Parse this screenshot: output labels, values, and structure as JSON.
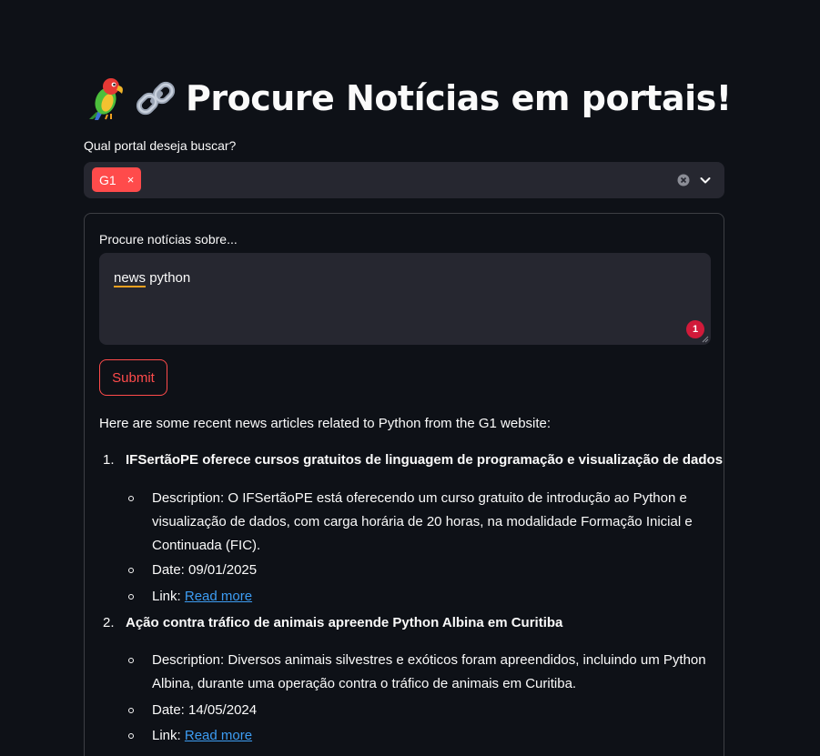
{
  "header": {
    "title": "Procure Notícias em portais!",
    "parrot_icon": "parrot-emoji",
    "link_icon": "link-emoji"
  },
  "portal_select": {
    "label": "Qual portal deseja buscar?",
    "selected_tag": "G1",
    "tag_remove": "×",
    "accent_color": "#ff4b4b"
  },
  "search_form": {
    "label": "Procure notícias sobre...",
    "textarea_value_word1": "news",
    "textarea_value_word2": " python",
    "badge_count": "1",
    "submit_label": "Submit"
  },
  "results": {
    "intro": "Here are some recent news articles related to Python from the G1 website:",
    "articles": [
      {
        "number": "1.",
        "title": "IFSertãoPE oferece cursos gratuitos de linguagem de programação e visualização de dados",
        "description": "Description: O IFSertãoPE está oferecendo um curso gratuito de introdução ao Python e visualização de dados, com carga horária de 20 horas, na modalidade Formação Inicial e Continuada (FIC).",
        "date": "Date: 09/01/2025",
        "link_prefix": "Link: ",
        "link_text": "Read more"
      },
      {
        "number": "2.",
        "title": "Ação contra tráfico de animais apreende Python Albina em Curitiba",
        "description": "Description: Diversos animais silvestres e exóticos foram apreendidos, incluindo um Python Albina, durante uma operação contra o tráfico de animais em Curitiba.",
        "date": "Date: 14/05/2024",
        "link_prefix": "Link: ",
        "link_text": "Read more"
      }
    ]
  }
}
